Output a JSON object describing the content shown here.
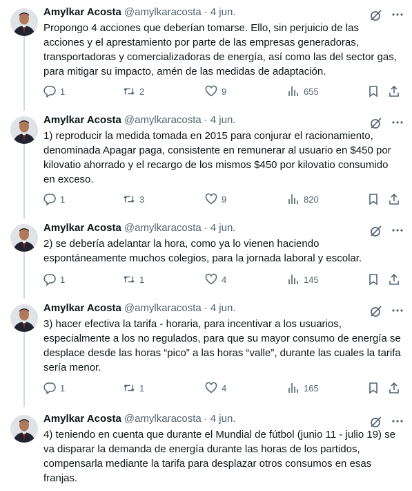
{
  "author": {
    "name": "Amylkar Acosta",
    "handle": "@amylkaracosta",
    "separator": "·"
  },
  "tweets": [
    {
      "date": "4 jun.",
      "text": "Propongo 4 acciones que deberían tomarse. Ello, sin perjuicio de las acciones y el aprestamiento por parte de las empresas generadoras, transportadoras y comercializadoras de energía, así como las del sector gas, para mitigar su impacto, amén de las medidas de adaptación.",
      "replies": "1",
      "reposts": "2",
      "likes": "9",
      "views": "655"
    },
    {
      "date": "4 jun.",
      "text": "1) reproducir la medida tomada en 2015 para conjurar el racionamiento, denominada Apagar paga, consistente en remunerar al usuario en $450 por kilovatio ahorrado y el recargo de los mismos $450 por kilovatio consumido en exceso.",
      "replies": "1",
      "reposts": "3",
      "likes": "9",
      "views": "820"
    },
    {
      "date": "4 jun.",
      "text": "2) se debería adelantar la hora, como ya lo vienen haciendo espontáneamente muchos colegios, para la jornada laboral y escolar.",
      "replies": "1",
      "reposts": "1",
      "likes": "4",
      "views": "145"
    },
    {
      "date": "4 jun.",
      "text": "3) hacer efectiva la tarifa - horaria, para incentivar a los usuarios, especialmente a los no regulados, para que su mayor consumo de energía se desplace desde las horas “pico” a las horas “valle”, durante las cuales la tarifa sería menor.",
      "replies": "1",
      "reposts": "1",
      "likes": "4",
      "views": "165"
    },
    {
      "date": "4 jun.",
      "text": "4) teniendo en cuenta que durante el Mundial de fútbol (junio 11 - julio 19) se va disparar la demanda de energía durante las horas de los partidos, compensarla mediante la tarifa para desplazar otros consumos en esas franjas."
    }
  ],
  "icons": {
    "reply": "reply-icon",
    "repost": "repost-icon",
    "like": "like-icon",
    "views": "views-icon",
    "bookmark": "bookmark-icon",
    "share": "share-icon",
    "grok": "grok-icon",
    "more": "more-icon"
  },
  "colors": {
    "text": "#0f1419",
    "secondary": "#536471",
    "thread_line": "#cfd9de"
  }
}
